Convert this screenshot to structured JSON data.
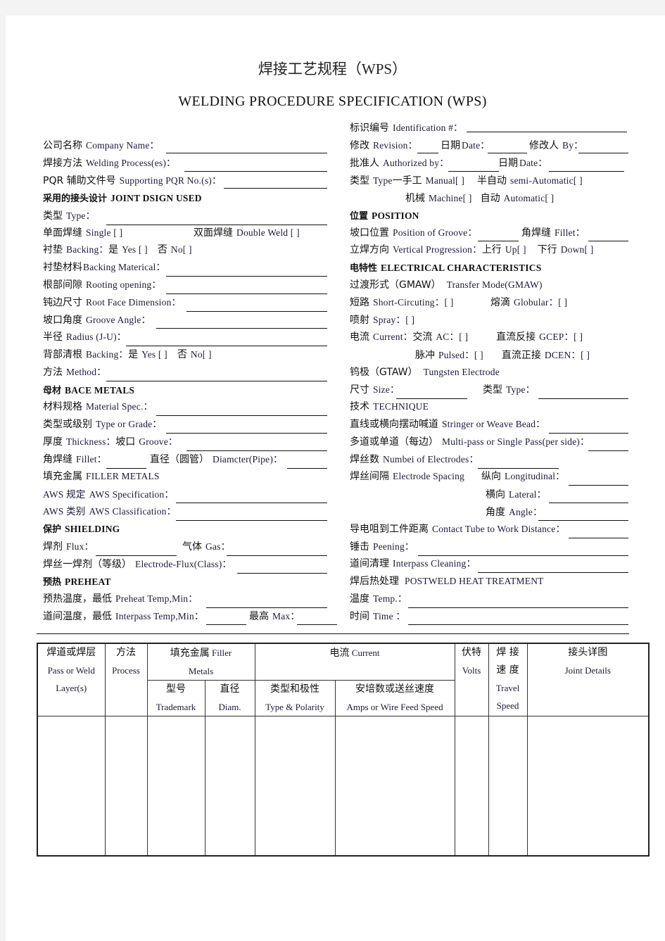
{
  "title_cn": "焊接工艺规程（WPS）",
  "title_en": "WELDING PROCEDURE SPECIFICATION (WPS)",
  "left": {
    "company": {
      "cn": "公司名称",
      "en": "Company Name：",
      "value": ""
    },
    "process": {
      "cn": "焊接方法",
      "en": "Welding Process(es)：",
      "value": ""
    },
    "pqr": {
      "cn": "PQR 辅助文件号",
      "en": "Supporting PQR No.(s)：",
      "value": ""
    },
    "joint_heading": {
      "cn": "采用的接头设计",
      "en": "JOINT DSIGN USED"
    },
    "type": {
      "cn": "类型",
      "en": "Type：",
      "value": ""
    },
    "single": {
      "cn": "单面焊缝",
      "en": "Single [    ]"
    },
    "double": {
      "cn": "双面焊缝",
      "en": "Double Weld [    ]"
    },
    "backing": {
      "cn": "衬垫",
      "en": "Backing：",
      "yes_cn": "是",
      "yes_en": "Yes [    ]",
      "no_cn": "否",
      "no_en": "No[    ]"
    },
    "backing_material": {
      "cn": "衬垫材料",
      "en": "Backing Materical：",
      "value": ""
    },
    "root_opening": {
      "cn": "根部间隙",
      "en": "Rooting opening：",
      "value": ""
    },
    "root_face": {
      "cn": "钝边尺寸",
      "en": "Root Face Dimension：",
      "value": ""
    },
    "groove_angle": {
      "cn": "坡口角度",
      "en": "Groove Angle：",
      "value": ""
    },
    "radius": {
      "cn": "半径",
      "en": "Radius (J-U)：",
      "value": ""
    },
    "back_gouging": {
      "cn": "背部清根",
      "en": "Backing：",
      "yes_cn": "是",
      "yes_en": "Yes [    ]",
      "no_cn": "否",
      "no_en": "No[    ]"
    },
    "method": {
      "cn": "方法",
      "en": "Method：",
      "value": ""
    },
    "base_heading": {
      "cn": "母材",
      "en": "BACE METALS"
    },
    "material_spec": {
      "cn": "材料规格",
      "en": "Material Spec.：",
      "value": ""
    },
    "type_grade": {
      "cn": "类型或级别",
      "en": "Type or Grade：",
      "value": ""
    },
    "thickness": {
      "cn": "厚度",
      "en": "Thickness：",
      "groove_cn": "坡口",
      "groove_en": "Groove：",
      "value": ""
    },
    "fillet": {
      "cn": "角焊缝",
      "en": "Fillet：",
      "value": ""
    },
    "diameter": {
      "cn": "直径（圆管）",
      "en": "Diamcter(Pipe)：",
      "value": ""
    },
    "filler_heading": {
      "cn": "填充金属",
      "en": "FILLER METALS"
    },
    "aws_spec": {
      "cn": "AWS  规定",
      "en": "AWS Specification：",
      "value": ""
    },
    "aws_class": {
      "cn": "AWS  类别",
      "en": "AWS Classification：",
      "value": ""
    },
    "shielding_heading": {
      "cn": "保护",
      "en": "SHIELDING"
    },
    "flux": {
      "cn": "焊剂",
      "en": "Flux：",
      "value": ""
    },
    "gas": {
      "cn": "气体",
      "en": "Gas：",
      "value": ""
    },
    "electrode_flux": {
      "cn": "焊丝一焊剂（等级）",
      "en": "Electrode-Flux(Class)：",
      "value": ""
    },
    "preheat_heading": {
      "cn": "预热",
      "en": "PREHEAT"
    },
    "preheat_min": {
      "cn": "预热温度，最低",
      "en": "Preheat Temp,Min：",
      "value": ""
    },
    "interpass_min": {
      "cn": "道间温度，最低",
      "en": "Interpass Temp,Min：",
      "value": ""
    },
    "interpass_max": {
      "cn": "最高",
      "en": "Max：",
      "value": ""
    }
  },
  "right": {
    "identification": {
      "cn": "标识编号",
      "en": "Identification #：",
      "value": ""
    },
    "revision": {
      "cn": "修改",
      "en": "Revision：",
      "value": ""
    },
    "rev_date": {
      "cn": "日期",
      "en": "Date：",
      "value": ""
    },
    "rev_by": {
      "cn": "修改人",
      "en": "By：",
      "value": ""
    },
    "authorized": {
      "cn": "批准人",
      "en": "Authorized by：",
      "value": ""
    },
    "auth_date": {
      "cn": "日期",
      "en": "Date：",
      "value": ""
    },
    "type_manual": {
      "cn": "类型",
      "en": "Type",
      "manual_cn": "一手工",
      "manual_en": "Manual[    ]",
      "semi_cn": "半自动",
      "semi_en": "semi-Automatic[    ]"
    },
    "type_machine": {
      "machine_cn": "机械",
      "machine_en": "Machine[    ]",
      "auto_cn": "自动",
      "auto_en": "Automatic[    ]"
    },
    "position_heading": {
      "cn": "位置",
      "en": "POSITION"
    },
    "groove_position": {
      "cn": "坡口位置",
      "en": "Position of Groove：",
      "value": ""
    },
    "fillet": {
      "cn": "角焊缝",
      "en": "Fillet：",
      "value": ""
    },
    "vertical": {
      "cn": "立焊方向",
      "en": "Vertical Progression：",
      "up_cn": "上行",
      "up_en": "Up[    ]",
      "down_cn": "下行",
      "down_en": "Down[    ]"
    },
    "electrical_heading": {
      "cn": "电特性",
      "en": "ELECTRICAL CHARACTERISTICS"
    },
    "transfer": {
      "cn": "过渡形式（GMAW）",
      "en": "Transfer Mode(GMAW)"
    },
    "short": {
      "cn": "短路",
      "en": "Short-Circuting：[    ]"
    },
    "globular": {
      "cn": "熔滴",
      "en": "Globular：[    ]"
    },
    "spray": {
      "cn": "喷射",
      "en": "Spray：[    ]"
    },
    "current": {
      "cn": "电流",
      "en": "Current：",
      "ac_cn": "交流",
      "ac_en": "AC：[    ]",
      "dcep_cn": "直流反接",
      "dcep_en": "GCEP：[    ]"
    },
    "pulsed": {
      "cn": "脉冲",
      "en": "Pulsed：[    ]",
      "dcen_cn": "直流正接",
      "dcen_en": "DCEN：[    ]"
    },
    "tungsten": {
      "cn": "钨极（GTAW）",
      "en": "Tungsten Electrode"
    },
    "size": {
      "cn": "尺寸",
      "en": "Size：",
      "value": "",
      "type_cn": "类型",
      "type_en": "Type：",
      "type_value": ""
    },
    "technique": {
      "cn": "技术",
      "en": "TECHNIQUE"
    },
    "stringer": {
      "cn": "直线或横向摆动喊道",
      "en": "Stringer or Weave Bead：",
      "value": ""
    },
    "multipass": {
      "cn": "多道或单道（每边）",
      "en": "Multi-pass or Single Pass(per side)：",
      "value": ""
    },
    "num_electrodes": {
      "cn": "焊丝数",
      "en": "Numbei of Electrodes：",
      "value": ""
    },
    "spacing": {
      "cn": "焊丝间隔",
      "en": "Electrode Spacing",
      "long_cn": "纵向",
      "long_en": "Longitudinal：",
      "value": ""
    },
    "lateral": {
      "cn": "横向",
      "en": "Lateral：",
      "value": ""
    },
    "angle": {
      "cn": "角度",
      "en": "Angle：",
      "value": ""
    },
    "contact_tube": {
      "cn": "导电咀到工件距离",
      "en": "Contact Tube to Work Distance：",
      "value": ""
    },
    "peening": {
      "cn": "锤击",
      "en": "Peening：",
      "value": ""
    },
    "interpass_cleaning": {
      "cn": "道间清理",
      "en": "Interpass Cleaning：",
      "value": ""
    },
    "pwht": {
      "cn": "焊后热处理",
      "en": "POSTWELD HEAT TREATMENT"
    },
    "temp": {
      "cn": "温度",
      "en": "Temp.：",
      "value": ""
    },
    "time": {
      "cn": "时间",
      "en": "Time  ：",
      "value": ""
    }
  },
  "table": {
    "pass": {
      "cn": "焊道或焊层",
      "en1": "Pass or Weld",
      "en2": "Layer(s)"
    },
    "process": {
      "cn": "方法",
      "en": "Process"
    },
    "filler": {
      "cn": "填充金属",
      "en1": "Filler",
      "en2": "Metals"
    },
    "trademark": {
      "cn": "型号",
      "en": "Trademark"
    },
    "diam": {
      "cn": "直径",
      "en": "Diam."
    },
    "current": {
      "cn": "电流",
      "en": "Current"
    },
    "polarity": {
      "cn": "类型和极性",
      "en": "Type & Polarity"
    },
    "amps": {
      "cn": "安培数或送丝速度",
      "en": "Amps or Wire Feed Speed"
    },
    "volts": {
      "cn": "伏特",
      "en": "Volts"
    },
    "travel": {
      "cn1": "焊 接",
      "cn2": "速 度",
      "en1": "Travel",
      "en2": "Speed"
    },
    "joint": {
      "cn": "接头详图",
      "en": "Joint Details"
    },
    "rows": [
      {
        "pass": "",
        "process": "",
        "trademark": "",
        "diam": "",
        "polarity": "",
        "amps": "",
        "volts": "",
        "travel": "",
        "joint": ""
      }
    ]
  }
}
